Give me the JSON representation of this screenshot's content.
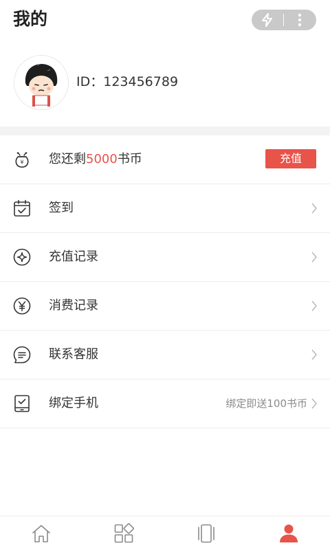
{
  "header": {
    "title": "我的",
    "capsule_icons": [
      "lightning-icon",
      "more-dots-icon"
    ]
  },
  "profile": {
    "id_text": "ID：123456789",
    "avatar_icon": "cartoon-avatar"
  },
  "menu": {
    "balance": {
      "prefix": "您还剩",
      "amount": "5000",
      "suffix": "书币",
      "button_label": "充值",
      "icon": "coin-bag-icon"
    },
    "items": [
      {
        "label": "签到",
        "icon": "calendar-check-icon",
        "note": ""
      },
      {
        "label": "充值记录",
        "icon": "sparkle-circle-icon",
        "note": ""
      },
      {
        "label": "消费记录",
        "icon": "yen-circle-icon",
        "note": ""
      },
      {
        "label": "联系客服",
        "icon": "chat-bubble-icon",
        "note": ""
      },
      {
        "label": "绑定手机",
        "icon": "phone-check-icon",
        "note": "绑定即送100书币"
      }
    ]
  },
  "bottom_nav": {
    "tabs": [
      {
        "icon": "home-icon",
        "active": false
      },
      {
        "icon": "category-icon",
        "active": false
      },
      {
        "icon": "bookshelf-icon",
        "active": false
      },
      {
        "icon": "user-icon",
        "active": true
      }
    ]
  },
  "colors": {
    "accent": "#e8534a",
    "capsule_bg": "#c9c9c9",
    "divider": "#ececec",
    "section_gap": "#f3f3f3",
    "inactive_icon": "#8a8a8a"
  }
}
